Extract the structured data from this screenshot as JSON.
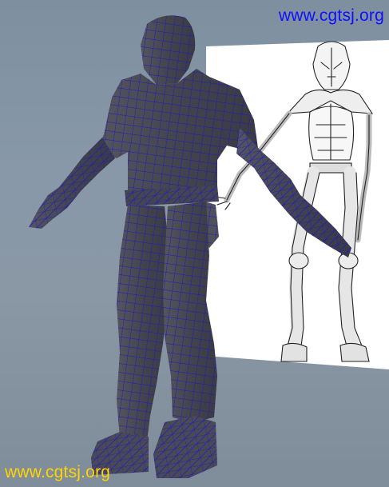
{
  "watermark": {
    "top_text": "www.cgtsj.org",
    "bottom_text": "www.cgtsj.org",
    "top_color": "#1010ff",
    "bottom_color": "#ffd400"
  },
  "scene": {
    "viewport_background": "#8798a8",
    "mesh_color": "#4a4a55",
    "wireframe_color": "#1a18c8",
    "reference_plane_color": "#ffffff",
    "reference_sketch_color": "#222222"
  }
}
